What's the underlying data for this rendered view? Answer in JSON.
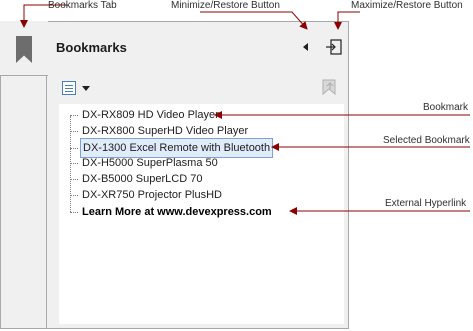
{
  "callouts": {
    "bookmarks_tab": "Bookmarks Tab",
    "minimize_restore": "Minimize/Restore Button",
    "maximize_restore": "Maximize/Restore Button",
    "bookmark": "Bookmark",
    "selected_bookmark": "Selected Bookmark",
    "external_hyperlink": "External Hyperlink"
  },
  "panel": {
    "title": "Bookmarks"
  },
  "bookmarks": [
    {
      "label": "DX-RX809 HD Video Player"
    },
    {
      "label": "DX-RX800 SuperHD Video Player"
    },
    {
      "label": "DX-1300 Excel Remote with Bluetooth",
      "selected": true
    },
    {
      "label": "DX-H5000 SuperPlasma 50"
    },
    {
      "label": "DX-B5000 SuperLCD 70"
    },
    {
      "label": "DX-XR750 Projector PlusHD"
    },
    {
      "label": "Learn More at www.devexpress.com",
      "link": true
    }
  ],
  "colors": {
    "callout_line": "#8b0000",
    "selection_bg": "#e1ecfb",
    "selection_border": "#7da2ce"
  },
  "icons": [
    "bookmark-icon",
    "chevron-left-icon",
    "maximize-icon",
    "list-view-icon",
    "dropdown-arrow-icon",
    "goto-bookmark-icon"
  ]
}
